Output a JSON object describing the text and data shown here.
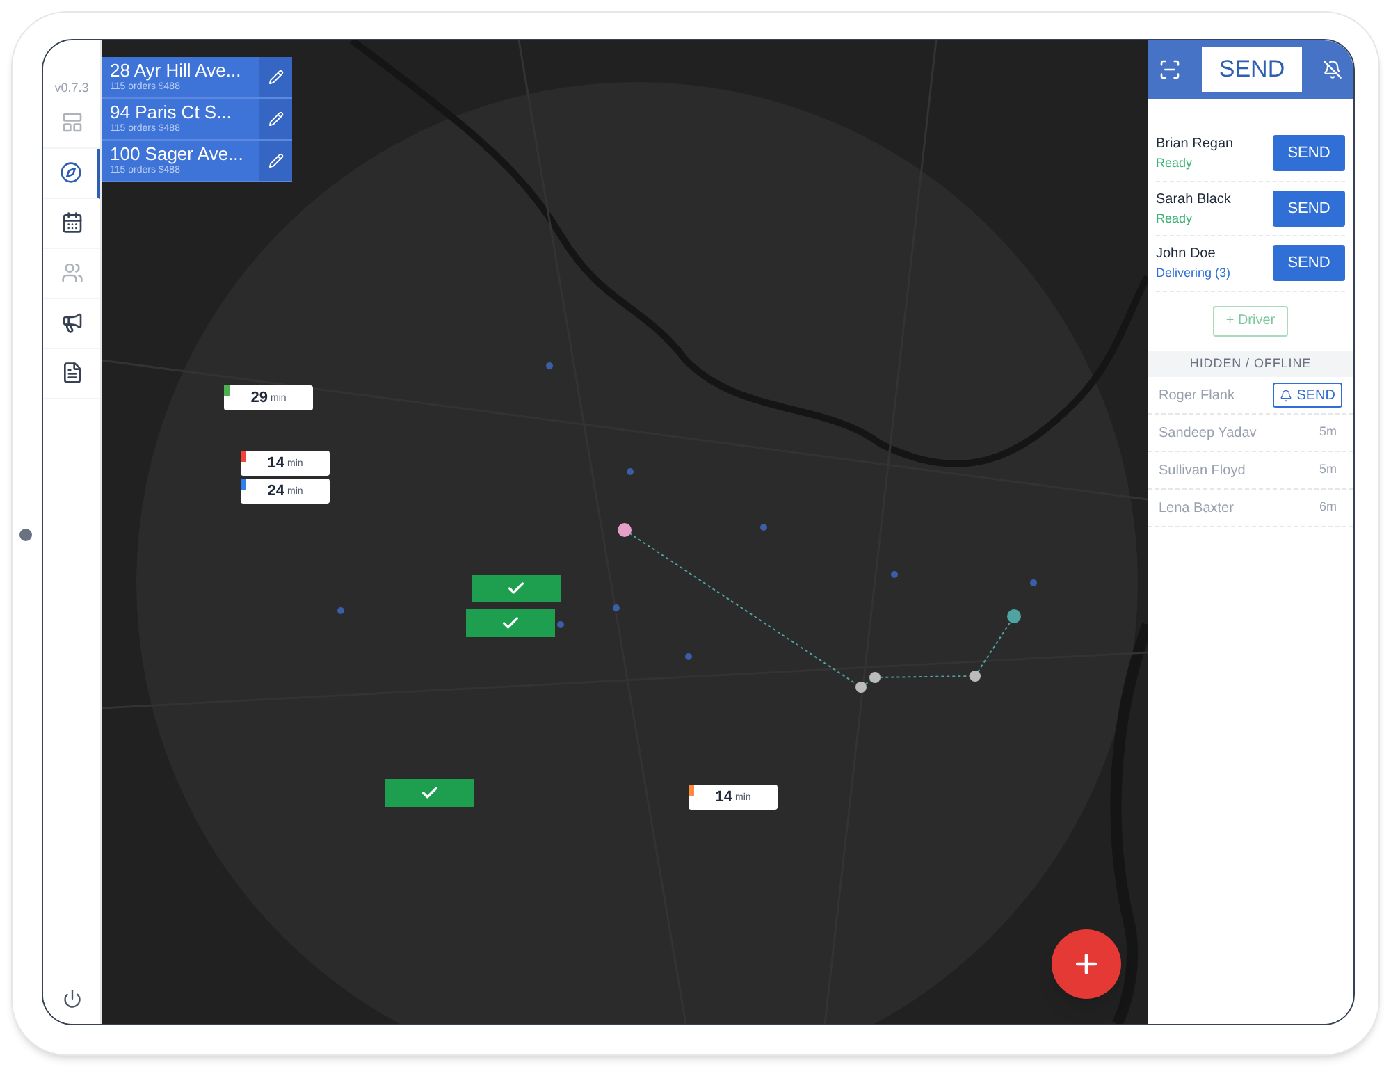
{
  "sidebar": {
    "version": "v0.7.3",
    "items": [
      {
        "kind": "layout",
        "selected": false,
        "disabled": true
      },
      {
        "kind": "compass",
        "selected": true,
        "disabled": false
      },
      {
        "kind": "calendar",
        "selected": false,
        "disabled": false
      },
      {
        "kind": "people",
        "selected": false,
        "disabled": true
      },
      {
        "kind": "megaphone",
        "selected": false,
        "disabled": false
      },
      {
        "kind": "document",
        "selected": false,
        "disabled": false
      }
    ]
  },
  "orders": [
    {
      "address": "28 Ayr Hill Ave...",
      "summary": "115 orders $488"
    },
    {
      "address": "94 Paris Ct S...",
      "summary": "115 orders $488"
    },
    {
      "address": "100 Sager Ave...",
      "summary": "115 orders $488"
    }
  ],
  "map": {
    "markers": [
      {
        "kind": "eta",
        "minutes": "29",
        "unit": "min",
        "color": "#4caf50"
      },
      {
        "kind": "eta",
        "minutes": "14",
        "unit": "min",
        "color": "#f44336"
      },
      {
        "kind": "eta",
        "minutes": "24",
        "unit": "min",
        "color": "#2f80ed"
      },
      {
        "kind": "eta",
        "minutes": "14",
        "unit": "min",
        "color": "#ff8a3d"
      },
      {
        "kind": "done"
      },
      {
        "kind": "done"
      },
      {
        "kind": "done"
      }
    ]
  },
  "header": {
    "send": "SEND"
  },
  "drivers": [
    {
      "name": "Brian Regan",
      "status": "Ready",
      "kind": "ready",
      "action": "SEND"
    },
    {
      "name": "Sarah Black",
      "status": "Ready",
      "kind": "ready",
      "action": "SEND"
    },
    {
      "name": "John Doe",
      "status": "Delivering (3)",
      "kind": "delivering",
      "action": "SEND"
    }
  ],
  "add_driver": "+ Driver",
  "offline": {
    "title": "HIDDEN / OFFLINE",
    "drivers": [
      {
        "name": "Roger Flank",
        "kind": "send",
        "action": "SEND"
      },
      {
        "name": "Sandeep Yadav",
        "kind": "time",
        "action": "5m"
      },
      {
        "name": "Sullivan Floyd",
        "kind": "time",
        "action": "5m"
      },
      {
        "name": "Lena Baxter",
        "kind": "time",
        "action": "6m"
      }
    ]
  }
}
